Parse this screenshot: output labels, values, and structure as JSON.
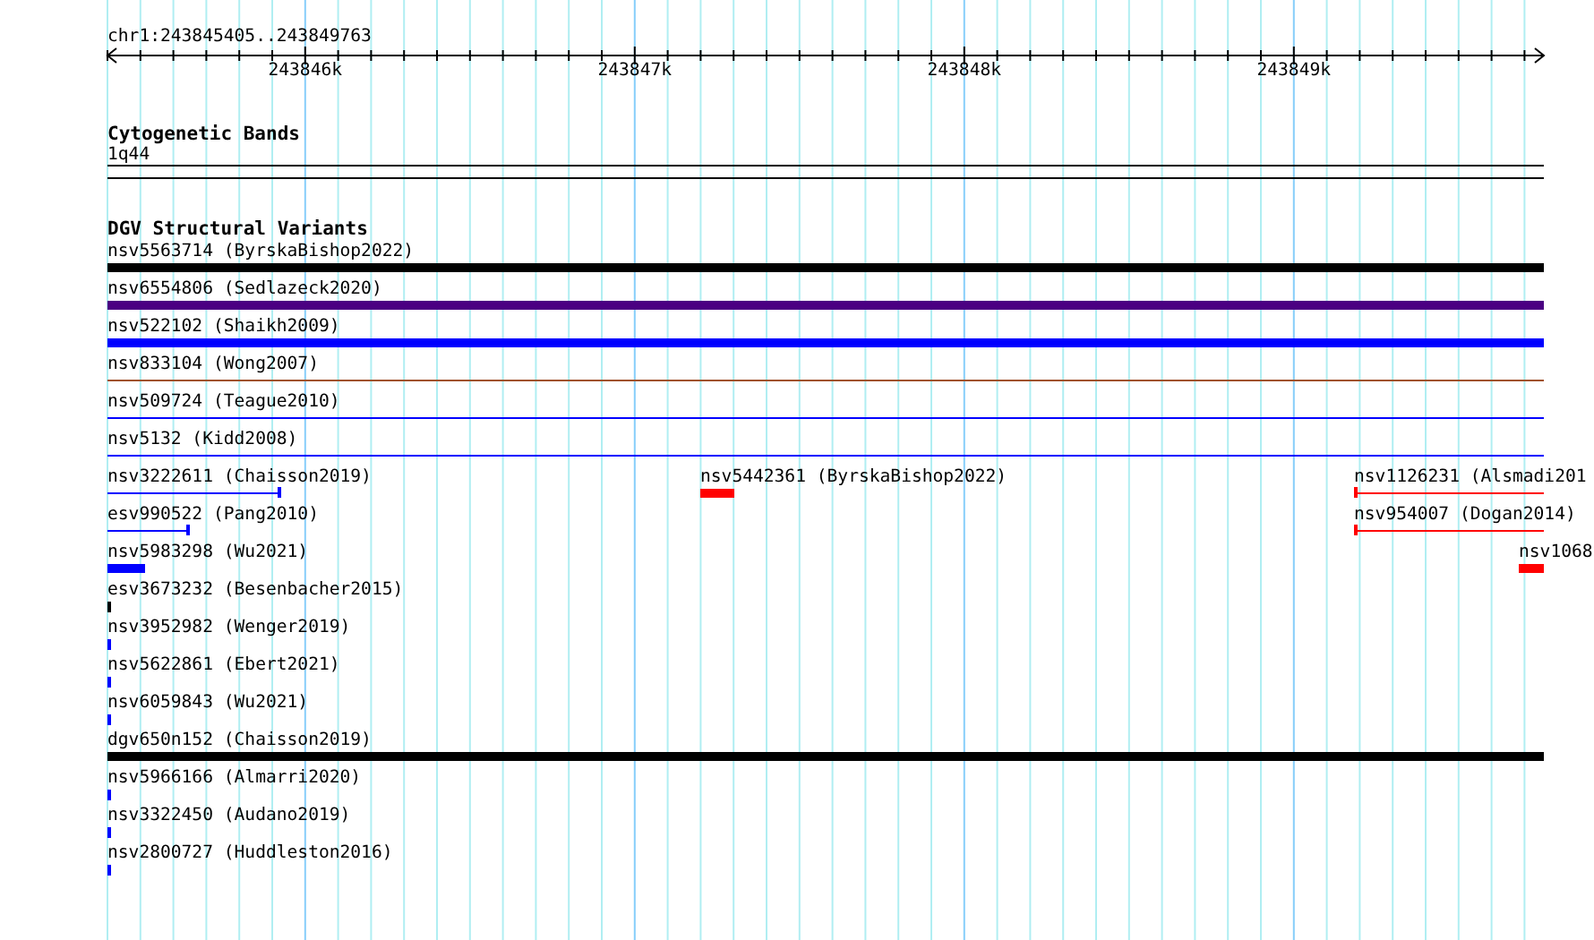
{
  "ruler": {
    "region": "chr1:243845405..243849763",
    "ticks": [
      "243846k",
      "243847k",
      "243848k",
      "243849k"
    ]
  },
  "tracks": [
    {
      "title": "Cytogenetic Bands",
      "rows": [
        [
          {
            "label": "1q44",
            "kind": "band",
            "color": "#000000"
          }
        ]
      ]
    },
    {
      "title": "DGV Structural Variants",
      "rows": [
        [
          {
            "label": "nsv5563714 (ByrskaBishop2022)",
            "kind": "full-bar",
            "color": "#000000"
          }
        ],
        [
          {
            "label": "nsv6554806 (Sedlazeck2020)",
            "kind": "full-bar",
            "color": "#4b0082"
          }
        ],
        [
          {
            "label": "nsv522102 (Shaikh2009)",
            "kind": "full-bar",
            "color": "#0000ff"
          }
        ],
        [
          {
            "label": "nsv833104 (Wong2007)",
            "kind": "full-line",
            "color": "#a0522d"
          }
        ],
        [
          {
            "label": "nsv509724 (Teague2010)",
            "kind": "full-line",
            "color": "#0000ff"
          }
        ],
        [
          {
            "label": "nsv5132 (Kidd2008)",
            "kind": "full-line",
            "color": "#0000ff"
          }
        ],
        [
          {
            "label": "nsv3222611 (Chaisson2019)",
            "kind": "end-tick-line",
            "color": "#0000ff"
          },
          {
            "label": "nsv5442361 (ByrskaBishop2022)",
            "kind": "bar",
            "color": "#ff0000"
          },
          {
            "label": "nsv1126231 (Alsmadi201",
            "kind": "start-tick-line",
            "color": "#ff0000"
          }
        ],
        [
          {
            "label": "esv990522 (Pang2010)",
            "kind": "end-tick-line",
            "color": "#0000ff"
          },
          {
            "label": "nsv954007 (Dogan2014)",
            "kind": "start-tick-line",
            "color": "#ff0000"
          }
        ],
        [
          {
            "label": "nsv5983298 (Wu2021)",
            "kind": "bar",
            "color": "#0000ff"
          },
          {
            "label": "nsv1068",
            "kind": "bar",
            "color": "#ff0000"
          }
        ],
        [
          {
            "label": "esv3673232 (Besenbacher2015)",
            "kind": "tick",
            "color": "#000000"
          }
        ],
        [
          {
            "label": "nsv3952982 (Wenger2019)",
            "kind": "tick",
            "color": "#0000ff"
          }
        ],
        [
          {
            "label": "nsv5622861 (Ebert2021)",
            "kind": "tick",
            "color": "#0000ff"
          }
        ],
        [
          {
            "label": "nsv6059843 (Wu2021)",
            "kind": "tick",
            "color": "#0000ff"
          }
        ],
        [
          {
            "label": "dgv650n152 (Chaisson2019)",
            "kind": "full-bar",
            "color": "#000000"
          }
        ],
        [
          {
            "label": "nsv5966166 (Almarri2020)",
            "kind": "tick",
            "color": "#0000ff"
          }
        ],
        [
          {
            "label": "nsv3322450 (Audano2019)",
            "kind": "tick",
            "color": "#0000ff"
          }
        ],
        [
          {
            "label": "nsv2800727 (Huddleston2016)",
            "kind": "tick",
            "color": "#0000ff"
          }
        ]
      ]
    }
  ]
}
